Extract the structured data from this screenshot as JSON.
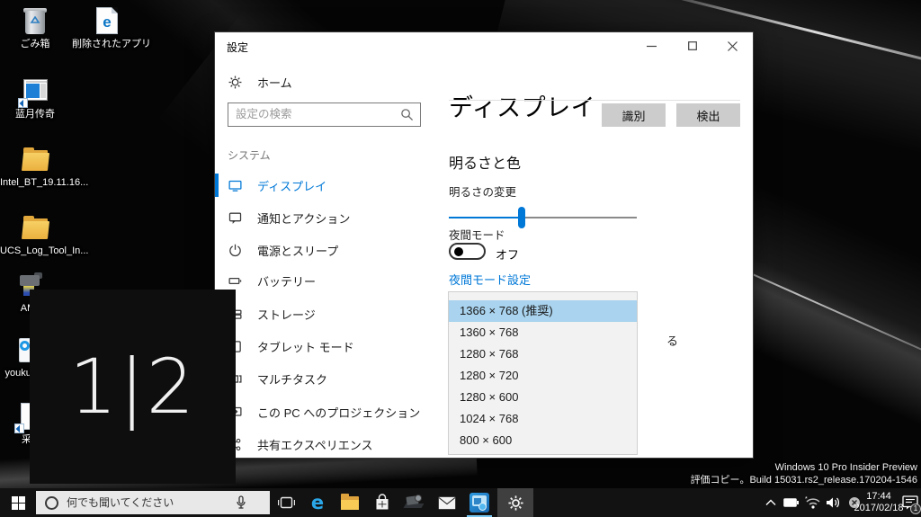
{
  "desktop": {
    "icons": [
      {
        "label": "ごみ箱"
      },
      {
        "label": "削除されたアプリ"
      },
      {
        "label": "蓝月传奇"
      },
      {
        "label": "Intel_BT_19.11.16..."
      },
      {
        "label": "UCS_Log_Tool_In..."
      },
      {
        "label": "AMC"
      },
      {
        "label": "youkuclient"
      },
      {
        "label": "采遍"
      }
    ],
    "identify_overlay_text": "1|2",
    "watermark_line1": "Windows 10 Pro Insider Preview",
    "watermark_line2": "評価コピー。Build 15031.rs2_release.170204-1546"
  },
  "window": {
    "title": "設定",
    "sidebar": {
      "home_label": "ホーム",
      "search_placeholder": "設定の検索",
      "section_label": "システム",
      "items": [
        {
          "label": "ディスプレイ",
          "selected": true
        },
        {
          "label": "通知とアクション"
        },
        {
          "label": "電源とスリープ"
        },
        {
          "label": "バッテリー"
        },
        {
          "label": "ストレージ"
        },
        {
          "label": "タブレット モード"
        },
        {
          "label": "マルチタスク"
        },
        {
          "label": "この PC へのプロジェクション"
        },
        {
          "label": "共有エクスペリエンス"
        }
      ]
    },
    "content": {
      "page_title": "ディスプレイ",
      "identify_button": "識別",
      "detect_button": "検出",
      "brightness_section": "明るさと色",
      "brightness_label": "明るさの変更",
      "brightness_percent": 39,
      "night_mode_label": "夜間モード",
      "night_mode_state": "オフ",
      "night_mode_link": "夜間モード設定",
      "hidden_text_fragment": "る",
      "resolution_options": [
        "1366 × 768 (推奨)",
        "1360 × 768",
        "1280 × 768",
        "1280 × 720",
        "1280 × 600",
        "1024 × 768",
        "800 × 600"
      ],
      "selected_resolution": "1366 × 768 (推奨)"
    }
  },
  "taskbar": {
    "search_placeholder": "何でも聞いてください",
    "tray": {
      "time": "17:44",
      "date": "2017/02/18",
      "notification_badge": "1"
    }
  },
  "colors": {
    "accent": "#0078d7",
    "selection_highlight": "#a9d3ee",
    "button_gray": "#cccccc",
    "taskbar_bg": "#121212",
    "edge_blue": "#2aa7e8"
  }
}
